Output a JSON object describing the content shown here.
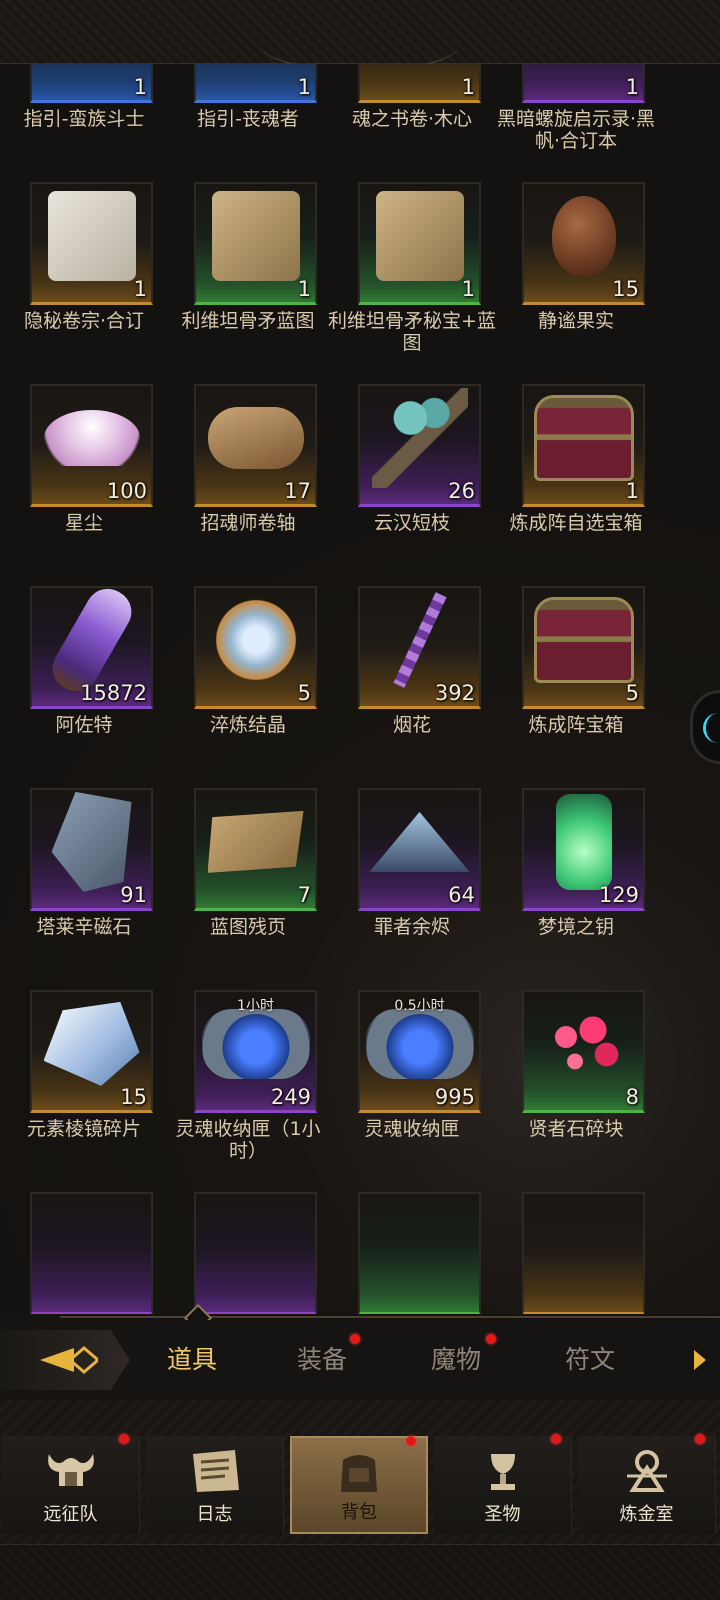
{
  "items": [
    {
      "name": "指引-蛮族斗士",
      "count": "1",
      "rarity": "blue",
      "icon": "partial"
    },
    {
      "name": "指引-丧魂者",
      "count": "1",
      "rarity": "blue",
      "icon": "partial"
    },
    {
      "name": "魂之书卷·木心",
      "count": "1",
      "rarity": "orange",
      "icon": "partial"
    },
    {
      "name": "黑暗螺旋启示录·黑帆·合订本",
      "count": "1",
      "rarity": "purple",
      "icon": "partial"
    },
    {
      "name": "隐秘卷宗·合订",
      "count": "1",
      "rarity": "orange",
      "icon": "scroll-white"
    },
    {
      "name": "利维坦骨矛蓝图",
      "count": "1",
      "rarity": "green",
      "icon": "scroll-tan"
    },
    {
      "name": "利维坦骨矛秘宝+蓝图",
      "count": "1",
      "rarity": "green",
      "icon": "scroll-tan"
    },
    {
      "name": "静谧果实",
      "count": "15",
      "rarity": "orange",
      "icon": "egg"
    },
    {
      "name": "星尘",
      "count": "100",
      "rarity": "orange",
      "icon": "dust"
    },
    {
      "name": "招魂师卷轴",
      "count": "17",
      "rarity": "orange",
      "icon": "roll"
    },
    {
      "name": "云汉短枝",
      "count": "26",
      "rarity": "purple",
      "icon": "branch"
    },
    {
      "name": "炼成阵自选宝箱",
      "count": "1",
      "rarity": "orange",
      "icon": "chest"
    },
    {
      "name": "阿佐特",
      "count": "15872",
      "rarity": "purple",
      "icon": "vial"
    },
    {
      "name": "淬炼结晶",
      "count": "5",
      "rarity": "orange",
      "icon": "crystal"
    },
    {
      "name": "烟花",
      "count": "392",
      "rarity": "orange",
      "icon": "firework"
    },
    {
      "name": "炼成阵宝箱",
      "count": "5",
      "rarity": "orange",
      "icon": "chest"
    },
    {
      "name": "塔莱辛磁石",
      "count": "91",
      "rarity": "purple",
      "icon": "rune"
    },
    {
      "name": "蓝图残页",
      "count": "7",
      "rarity": "green",
      "icon": "page"
    },
    {
      "name": "罪者余烬",
      "count": "64",
      "rarity": "purple",
      "icon": "pile"
    },
    {
      "name": "梦境之钥",
      "count": "129",
      "rarity": "purple",
      "icon": "bottle"
    },
    {
      "name": "元素棱镜碎片",
      "count": "15",
      "rarity": "orange",
      "icon": "prism"
    },
    {
      "name": "灵魂收纳匣（1小时）",
      "count": "249",
      "rarity": "purple",
      "icon": "soulbox",
      "timer": "1小时"
    },
    {
      "name": "灵魂收纳匣",
      "count": "995",
      "rarity": "orange",
      "icon": "soulbox",
      "timer": "0.5小时"
    },
    {
      "name": "贤者石碎块",
      "count": "8",
      "rarity": "green",
      "icon": "gem"
    },
    {
      "name": "",
      "count": "",
      "rarity": "purple",
      "icon": "partial"
    },
    {
      "name": "",
      "count": "",
      "rarity": "purple",
      "icon": "partial"
    },
    {
      "name": "",
      "count": "",
      "rarity": "green",
      "icon": "partial"
    },
    {
      "name": "",
      "count": "",
      "rarity": "orange",
      "icon": "partial"
    }
  ],
  "category_tabs": [
    {
      "label": "道具",
      "active": true,
      "badge": false
    },
    {
      "label": "装备",
      "active": false,
      "badge": true
    },
    {
      "label": "魔物",
      "active": false,
      "badge": true
    },
    {
      "label": "符文",
      "active": false,
      "badge": false
    }
  ],
  "nav": [
    {
      "label": "远征队",
      "icon": "horned-helmet-icon",
      "active": false,
      "badge": true
    },
    {
      "label": "日志",
      "icon": "journal-icon",
      "active": false,
      "badge": false
    },
    {
      "label": "背包",
      "icon": "backpack-icon",
      "active": true,
      "badge": true
    },
    {
      "label": "圣物",
      "icon": "chalice-icon",
      "active": false,
      "badge": true
    },
    {
      "label": "炼金室",
      "icon": "alchemy-icon",
      "active": false,
      "badge": true
    }
  ],
  "colors": {
    "accent": "#f1c86b",
    "badge": "#e31818",
    "orange": "#c68a2e",
    "purple": "#8d44c6",
    "green": "#4eb342",
    "blue": "#3f76d8"
  }
}
